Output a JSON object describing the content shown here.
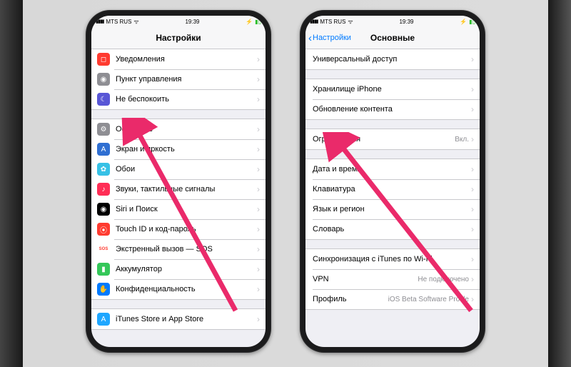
{
  "status": {
    "carrier": "MTS RUS",
    "time": "19:39"
  },
  "left": {
    "title": "Настройки",
    "g1": [
      {
        "icon_bg": "#ff3b30",
        "glyph": "◻︎",
        "label": "Уведомления"
      },
      {
        "icon_bg": "#8e8e93",
        "glyph": "◉",
        "label": "Пункт управления"
      },
      {
        "icon_bg": "#5856d6",
        "glyph": "☾",
        "label": "Не беспокоить"
      }
    ],
    "g2": [
      {
        "icon_bg": "#8e8e93",
        "glyph": "⚙",
        "label": "Основные"
      },
      {
        "icon_bg": "#2f6fd2",
        "glyph": "A",
        "label": "Экран и яркость"
      },
      {
        "icon_bg": "#36c1e6",
        "glyph": "✿",
        "label": "Обои"
      },
      {
        "icon_bg": "#ff2d55",
        "glyph": "♪",
        "label": "Звуки, тактильные сигналы"
      },
      {
        "icon_bg": "#000000",
        "glyph": "◉",
        "label": "Siri и Поиск"
      },
      {
        "icon_bg": "#ff3b30",
        "glyph": "⦿",
        "label": "Touch ID и код-пароль"
      },
      {
        "icon_bg": "#ffffff",
        "glyph": "SOS",
        "label": "Экстренный вызов — SOS",
        "txtcolor": "#ff3b30"
      },
      {
        "icon_bg": "#34c759",
        "glyph": "▮",
        "label": "Аккумулятор"
      },
      {
        "icon_bg": "#007aff",
        "glyph": "✋",
        "label": "Конфиденциальность"
      }
    ],
    "g3": [
      {
        "icon_bg": "#1fa7ff",
        "glyph": "A",
        "label": "iTunes Store и App Store"
      }
    ]
  },
  "right": {
    "back": "Настройки",
    "title": "Основные",
    "g1": [
      {
        "label": "Универсальный доступ"
      }
    ],
    "g2": [
      {
        "label": "Хранилище iPhone"
      },
      {
        "label": "Обновление контента"
      }
    ],
    "g3": [
      {
        "label": "Ограничения",
        "detail": "Вкл."
      }
    ],
    "g4": [
      {
        "label": "Дата и время"
      },
      {
        "label": "Клавиатура"
      },
      {
        "label": "Язык и регион"
      },
      {
        "label": "Словарь"
      }
    ],
    "g5": [
      {
        "label": "Синхронизация с iTunes по Wi-Fi"
      },
      {
        "label": "VPN",
        "detail": "Не подключено"
      },
      {
        "label": "Профиль",
        "detail": "iOS Beta Software Profile"
      }
    ]
  }
}
